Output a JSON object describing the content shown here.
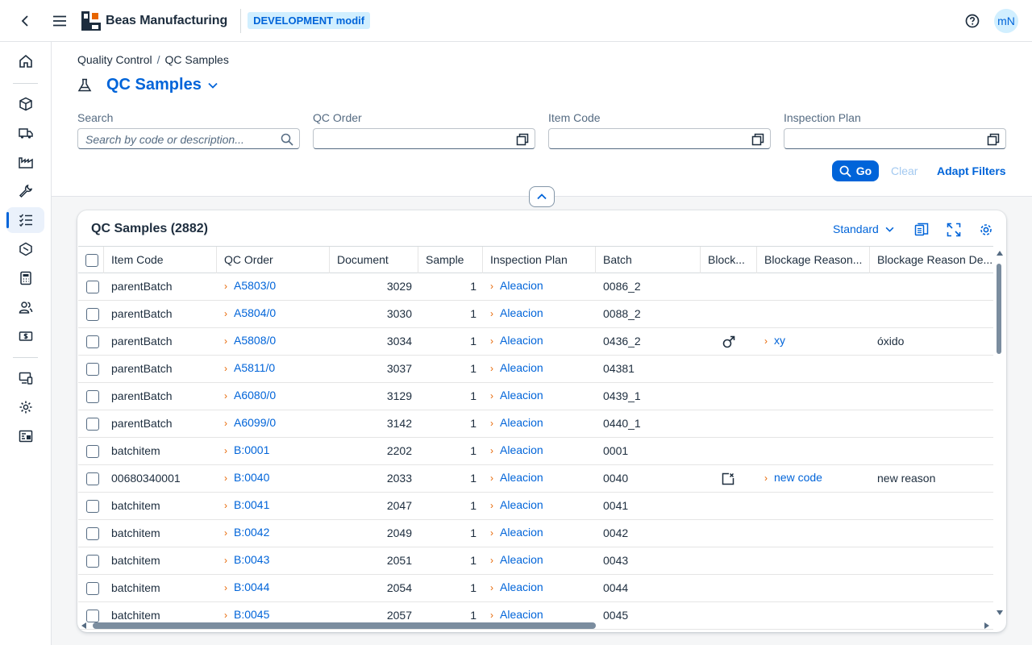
{
  "shell": {
    "brand": "Beas Manufacturing",
    "environment": "DEVELOPMENT modif",
    "avatar_initials": "mN"
  },
  "breadcrumb": [
    "Quality Control",
    "QC Samples"
  ],
  "page": {
    "title": "QC Samples"
  },
  "filters": {
    "search": {
      "label": "Search",
      "placeholder": "Search by code or description..."
    },
    "qc_order": {
      "label": "QC Order",
      "value": ""
    },
    "item_code": {
      "label": "Item Code",
      "value": ""
    },
    "inspection_plan": {
      "label": "Inspection Plan",
      "value": ""
    },
    "go_label": "Go",
    "clear_label": "Clear",
    "adapt_label": "Adapt Filters"
  },
  "table": {
    "title": "QC Samples (2882)",
    "variant": "Standard",
    "columns": [
      "Item Code",
      "QC Order",
      "Document",
      "Sample",
      "Inspection Plan",
      "Batch",
      "Block...",
      "Blockage Reason...",
      "Blockage Reason De..."
    ],
    "rows": [
      {
        "item": "parentBatch",
        "order": "A5803/0",
        "doc": "3029",
        "sample": "1",
        "plan": "Aleacion",
        "batch": "0086_2",
        "block_icon": "",
        "reason": "",
        "desc": ""
      },
      {
        "item": "parentBatch",
        "order": "A5804/0",
        "doc": "3030",
        "sample": "1",
        "plan": "Aleacion",
        "batch": "0088_2",
        "block_icon": "",
        "reason": "",
        "desc": ""
      },
      {
        "item": "parentBatch",
        "order": "A5808/0",
        "doc": "3034",
        "sample": "1",
        "plan": "Aleacion",
        "batch": "0436_2",
        "block_icon": "male",
        "reason": "xy",
        "desc": "óxido"
      },
      {
        "item": "parentBatch",
        "order": "A5811/0",
        "doc": "3037",
        "sample": "1",
        "plan": "Aleacion",
        "batch": "04381",
        "block_icon": "",
        "reason": "",
        "desc": ""
      },
      {
        "item": "parentBatch",
        "order": "A6080/0",
        "doc": "3129",
        "sample": "1",
        "plan": "Aleacion",
        "batch": "0439_1",
        "block_icon": "",
        "reason": "",
        "desc": ""
      },
      {
        "item": "parentBatch",
        "order": "A6099/0",
        "doc": "3142",
        "sample": "1",
        "plan": "Aleacion",
        "batch": "0440_1",
        "block_icon": "",
        "reason": "",
        "desc": ""
      },
      {
        "item": "batchitem",
        "order": "B:0001",
        "doc": "2202",
        "sample": "1",
        "plan": "Aleacion",
        "batch": "0001",
        "block_icon": "",
        "reason": "",
        "desc": ""
      },
      {
        "item": "00680340001",
        "order": "B:0040",
        "doc": "2033",
        "sample": "1",
        "plan": "Aleacion",
        "batch": "0040",
        "block_icon": "blocked",
        "reason": "new code",
        "desc": "new reason"
      },
      {
        "item": "batchitem",
        "order": "B:0041",
        "doc": "2047",
        "sample": "1",
        "plan": "Aleacion",
        "batch": "0041",
        "block_icon": "",
        "reason": "",
        "desc": ""
      },
      {
        "item": "batchitem",
        "order": "B:0042",
        "doc": "2049",
        "sample": "1",
        "plan": "Aleacion",
        "batch": "0042",
        "block_icon": "",
        "reason": "",
        "desc": ""
      },
      {
        "item": "batchitem",
        "order": "B:0043",
        "doc": "2051",
        "sample": "1",
        "plan": "Aleacion",
        "batch": "0043",
        "block_icon": "",
        "reason": "",
        "desc": ""
      },
      {
        "item": "batchitem",
        "order": "B:0044",
        "doc": "2054",
        "sample": "1",
        "plan": "Aleacion",
        "batch": "0044",
        "block_icon": "",
        "reason": "",
        "desc": ""
      },
      {
        "item": "batchitem",
        "order": "B:0045",
        "doc": "2057",
        "sample": "1",
        "plan": "Aleacion",
        "batch": "0045",
        "block_icon": "",
        "reason": "",
        "desc": ""
      }
    ]
  },
  "colors": {
    "accent": "#0064d9",
    "link_arrow": "#e76500"
  }
}
